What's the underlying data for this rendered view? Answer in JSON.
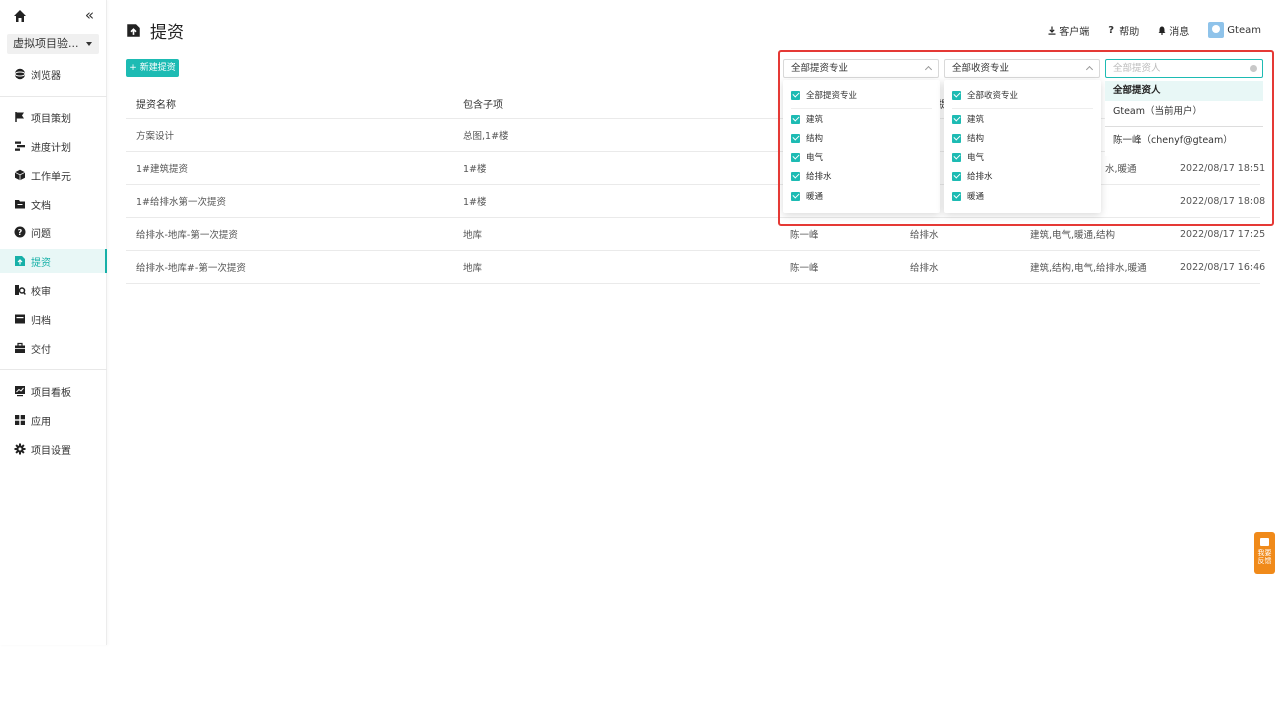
{
  "sidebar": {
    "project": "虚拟项目验...",
    "items": [
      {
        "label": "浏览器",
        "icon": "globe-icon"
      },
      {
        "label": "项目策划",
        "icon": "flag-icon"
      },
      {
        "label": "进度计划",
        "icon": "gantt-icon"
      },
      {
        "label": "工作单元",
        "icon": "cube-icon"
      },
      {
        "label": "文档",
        "icon": "folder-icon"
      },
      {
        "label": "问题",
        "icon": "question-icon"
      },
      {
        "label": "提资",
        "icon": "upload-doc-icon",
        "active": true
      },
      {
        "label": "校审",
        "icon": "review-icon"
      },
      {
        "label": "归档",
        "icon": "archive-icon"
      },
      {
        "label": "交付",
        "icon": "briefcase-icon"
      },
      {
        "label": "项目看板",
        "icon": "dashboard-icon"
      },
      {
        "label": "应用",
        "icon": "apps-icon"
      },
      {
        "label": "项目设置",
        "icon": "gear-icon"
      }
    ]
  },
  "header": {
    "title": "提资",
    "download_client": "客户端",
    "help": "帮助",
    "messages": "消息",
    "user": "Gteam"
  },
  "toolbar": {
    "new_button": "+ 新建提资"
  },
  "table": {
    "columns": [
      "提资名称",
      "包含子项",
      "提",
      "",
      "",
      ""
    ],
    "rows": [
      {
        "name": "方案设计",
        "sub": "总图,1#楼",
        "submitter": "",
        "major": "",
        "receivers": "",
        "time": ""
      },
      {
        "name": "1#建筑提资",
        "sub": "1#楼",
        "submitter": "",
        "major": "",
        "receivers": "水,暖通",
        "time": "2022/08/17 18:51"
      },
      {
        "name": "1#给排水第一次提资",
        "sub": "1#楼",
        "submitter": "",
        "major": "",
        "receivers": "",
        "time": "2022/08/17 18:08"
      },
      {
        "name": "给排水-地库-第一次提资",
        "sub": "地库",
        "submitter": "陈一峰",
        "major": "给排水",
        "receivers": "建筑,电气,暖通,结构",
        "time": "2022/08/17 17:25"
      },
      {
        "name": "给排水-地库#-第一次提资",
        "sub": "地库",
        "submitter": "陈一峰",
        "major": "给排水",
        "receivers": "建筑,结构,电气,给排水,暖通",
        "time": "2022/08/17 16:46"
      }
    ]
  },
  "filters": {
    "submit_major": {
      "label": "全部提资专业",
      "options": [
        "全部提资专业",
        "建筑",
        "结构",
        "电气",
        "给排水",
        "暖通"
      ]
    },
    "receive_major": {
      "label": "全部收资专业",
      "options": [
        "全部收资专业",
        "建筑",
        "结构",
        "电气",
        "给排水",
        "暖通"
      ]
    },
    "submitter": {
      "placeholder": "全部提资人",
      "options": [
        "全部提资人",
        "Gteam（当前用户）",
        "陈一峰（chenyf@gteam）"
      ]
    }
  },
  "feedback": "我要反馈",
  "colors": {
    "accent": "#1dbbb3",
    "highlight_box": "#e53935",
    "feedback": "#f08a1a"
  }
}
